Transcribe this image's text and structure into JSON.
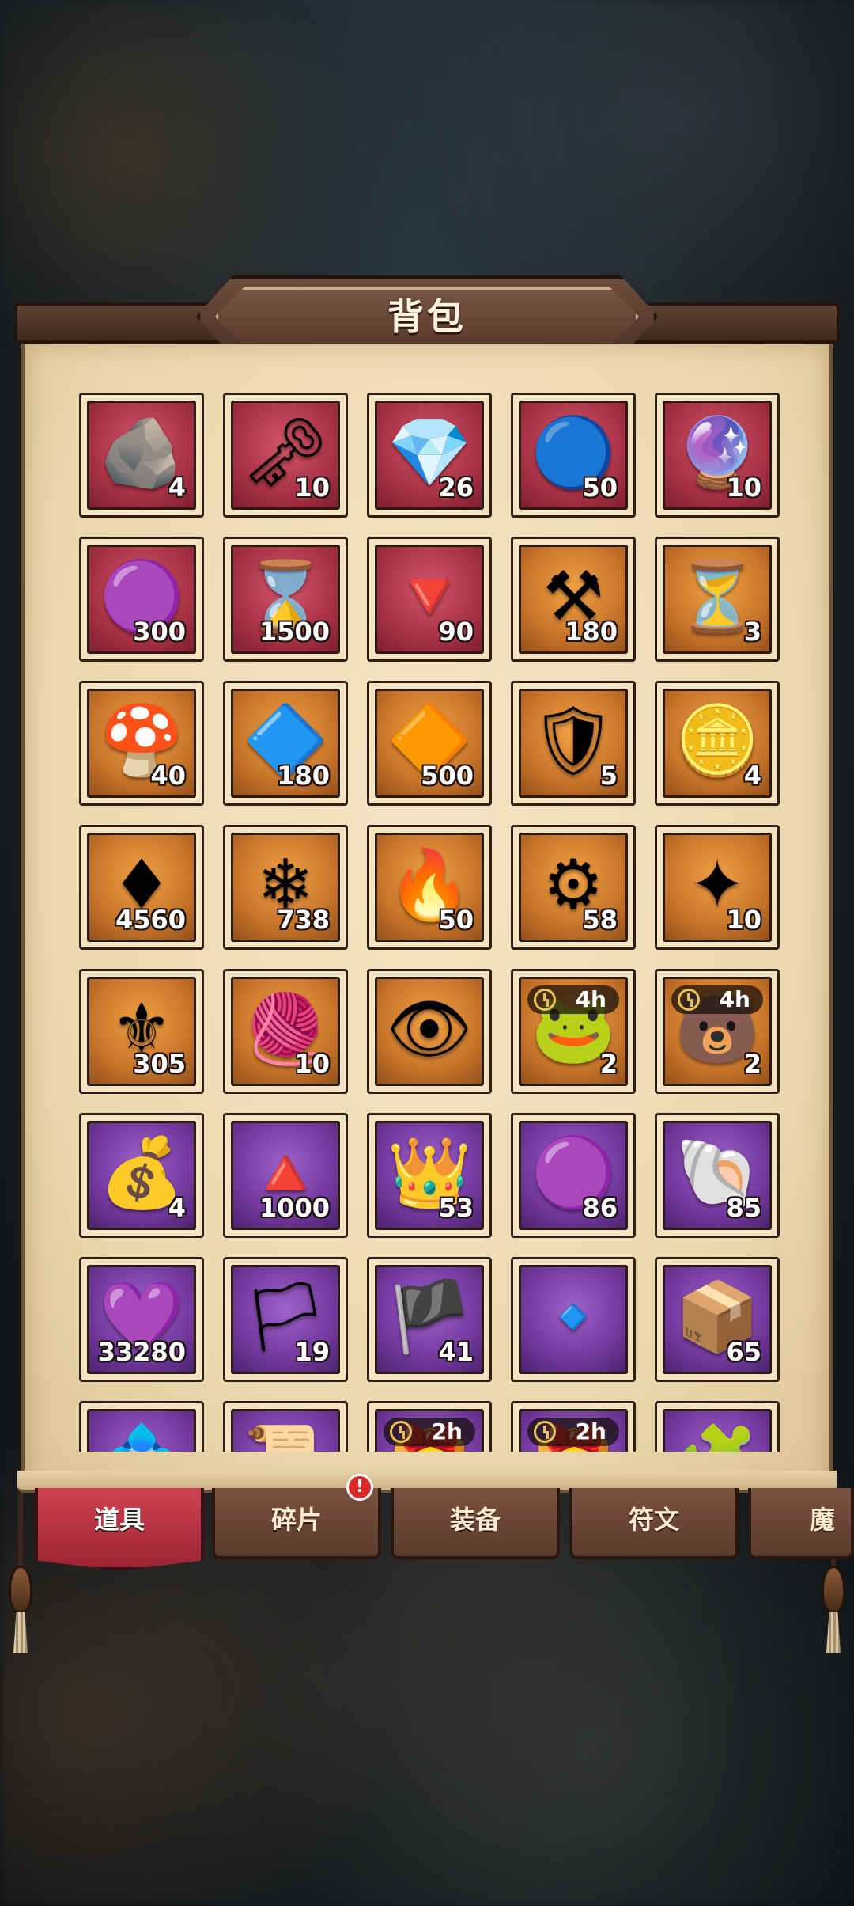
{
  "title": "背包",
  "tabs": [
    {
      "label": "道具",
      "active": true
    },
    {
      "label": "碎片",
      "active": false,
      "badge": "!"
    },
    {
      "label": "装备",
      "active": false
    },
    {
      "label": "符文",
      "active": false
    },
    {
      "label": "魔",
      "active": false
    }
  ],
  "items": [
    {
      "icon": "rune-stone-icon",
      "glyph": "🪨",
      "rarity": "red",
      "qty": "4"
    },
    {
      "icon": "golden-key-icon",
      "glyph": "🗝",
      "rarity": "red",
      "qty": "10"
    },
    {
      "icon": "blue-gem-crown-icon",
      "glyph": "💎",
      "rarity": "red",
      "qty": "26"
    },
    {
      "icon": "blue-orb-icon",
      "glyph": "🔵",
      "rarity": "red",
      "qty": "50"
    },
    {
      "icon": "purple-crystal-bottle-icon",
      "glyph": "🔮",
      "rarity": "red",
      "qty": "10"
    },
    {
      "icon": "purple-crystal-shard-icon",
      "glyph": "🟣",
      "rarity": "red",
      "qty": "300"
    },
    {
      "icon": "hourglass-coin-icon",
      "glyph": "⌛",
      "rarity": "red",
      "qty": "1500"
    },
    {
      "icon": "red-crystal-claw-icon",
      "glyph": "🔻",
      "rarity": "red",
      "qty": "90"
    },
    {
      "icon": "anvil-hammer-icon",
      "glyph": "⚒",
      "rarity": "orange",
      "qty": "180"
    },
    {
      "icon": "hourglass-icon",
      "glyph": "⏳",
      "rarity": "orange",
      "qty": "3"
    },
    {
      "icon": "mushroom-totem-icon",
      "glyph": "🍄",
      "rarity": "orange",
      "qty": "40"
    },
    {
      "icon": "dark-crystal-ring-icon",
      "glyph": "🔷",
      "rarity": "orange",
      "qty": "180"
    },
    {
      "icon": "purple-crystal-ring-icon",
      "glyph": "🔶",
      "rarity": "orange",
      "qty": "500"
    },
    {
      "icon": "silver-shield-stone-icon",
      "glyph": "🛡",
      "rarity": "orange",
      "qty": "5"
    },
    {
      "icon": "winged-silver-coin-icon",
      "glyph": "🪙",
      "rarity": "orange",
      "qty": "4"
    },
    {
      "icon": "red-gem-icon",
      "glyph": "♦",
      "rarity": "orange",
      "qty": "4560"
    },
    {
      "icon": "ice-crystal-cluster-icon",
      "glyph": "❄",
      "rarity": "orange",
      "qty": "738"
    },
    {
      "icon": "fire-beast-orb-icon",
      "glyph": "🔥",
      "rarity": "orange",
      "qty": "50"
    },
    {
      "icon": "golden-gear-icon",
      "glyph": "⚙",
      "rarity": "orange",
      "qty": "58"
    },
    {
      "icon": "golden-crystal-shard-icon",
      "glyph": "✦",
      "rarity": "orange",
      "qty": "10"
    },
    {
      "icon": "golden-artifact-icon",
      "glyph": "⚜",
      "rarity": "orange",
      "qty": "305"
    },
    {
      "icon": "yarn-ball-icon",
      "glyph": "🧶",
      "rarity": "orange",
      "qty": "10"
    },
    {
      "icon": "spiked-eye-orb-icon",
      "glyph": "👁",
      "rarity": "orange",
      "qty": ""
    },
    {
      "icon": "green-creature-chest-icon",
      "glyph": "🐸",
      "rarity": "orange",
      "qty": "2",
      "timer": "4h"
    },
    {
      "icon": "gold-creature-chest-icon",
      "glyph": "🐻",
      "rarity": "orange",
      "qty": "2",
      "timer": "4h"
    },
    {
      "icon": "scroll-sack-icon",
      "glyph": "💰",
      "rarity": "purple",
      "qty": "4"
    },
    {
      "icon": "red-crystal-cluster-icon",
      "glyph": "🔺",
      "rarity": "purple",
      "qty": "1000"
    },
    {
      "icon": "crowned-crystal-emblem-icon",
      "glyph": "👑",
      "rarity": "purple",
      "qty": "53"
    },
    {
      "icon": "purple-orb-icon",
      "glyph": "🟣",
      "rarity": "purple",
      "qty": "86"
    },
    {
      "icon": "golden-shell-icon",
      "glyph": "🐚",
      "rarity": "purple",
      "qty": "85"
    },
    {
      "icon": "violet-crystal-icon",
      "glyph": "💜",
      "rarity": "purple",
      "qty": "33280"
    },
    {
      "icon": "blue-banner-icon",
      "glyph": "🏳",
      "rarity": "purple",
      "qty": "19"
    },
    {
      "icon": "winged-banner-icon",
      "glyph": "🏴",
      "rarity": "purple",
      "qty": "41"
    },
    {
      "icon": "blue-diamond-icon",
      "glyph": "🔹",
      "rarity": "purple",
      "qty": ""
    },
    {
      "icon": "dark-chest-icon",
      "glyph": "📦",
      "rarity": "purple",
      "qty": "65"
    },
    {
      "icon": "crystal-pile-icon",
      "glyph": "💠",
      "rarity": "purple",
      "qty": ""
    },
    {
      "icon": "scroll-icon",
      "glyph": "📜",
      "rarity": "purple",
      "qty": ""
    },
    {
      "icon": "brown-chest-icon",
      "glyph": "🎁",
      "rarity": "purple",
      "qty": "",
      "timer": "2h"
    },
    {
      "icon": "brown-chest-icon",
      "glyph": "🎁",
      "rarity": "purple",
      "qty": "",
      "timer": "2h"
    },
    {
      "icon": "blue-puzzle-chest-icon",
      "glyph": "🧩",
      "rarity": "purple",
      "qty": ""
    }
  ],
  "colors": {
    "red": "#a93245",
    "orange": "#c9752a",
    "purple": "#74399e",
    "tab_active": "#c0384a",
    "tab_inactive": "#6b4636"
  }
}
